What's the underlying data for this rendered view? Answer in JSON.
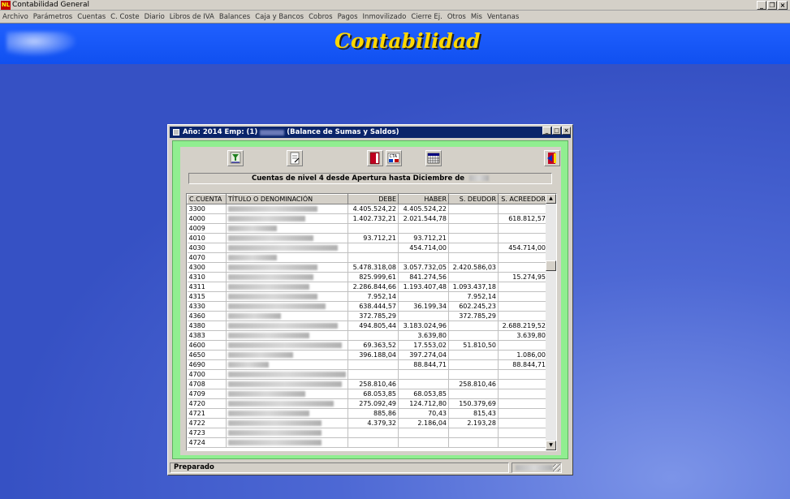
{
  "app": {
    "title": "Contabilidad General",
    "banner_title": "Contabilidad",
    "menu": [
      "Archivo",
      "Parámetros",
      "Cuentas",
      "C. Coste",
      "Diario",
      "Libros de IVA",
      "Balances",
      "Caja y Bancos",
      "Cobros",
      "Pagos",
      "Inmovilizado",
      "Cierre Ej.",
      "Otros",
      "Mis",
      "Ventanas"
    ]
  },
  "child_window": {
    "title_prefix": "Año: 2014 Emp: (1)",
    "title_suffix": "(Balance de Sumas y Saldos)",
    "header": "Cuentas de nivel 4 desde Apertura hasta Diciembre de",
    "status": "Preparado"
  },
  "toolbar_icons": [
    "filter-icon",
    "edit-document-icon",
    "exit-door-icon",
    "cta-account-icon",
    "calendar-grid-icon",
    "close-exit-icon"
  ],
  "grid": {
    "columns": [
      "C.CUENTA",
      "TÍTULO O DENOMINACIÓN",
      "DEBE",
      "HABER",
      "S. DEUDOR",
      "S. ACREEDOR"
    ],
    "rows": [
      [
        "3300",
        "",
        "4.405.524,22",
        "4.405.524,22",
        "",
        ""
      ],
      [
        "4000",
        "",
        "1.402.732,21",
        "2.021.544,78",
        "",
        "618.812,57"
      ],
      [
        "4009",
        "",
        "",
        "",
        "",
        ""
      ],
      [
        "4010",
        "",
        "93.712,21",
        "93.712,21",
        "",
        ""
      ],
      [
        "4030",
        "",
        "",
        "454.714,00",
        "",
        "454.714,00"
      ],
      [
        "4070",
        "",
        "",
        "",
        "",
        ""
      ],
      [
        "4300",
        "",
        "5.478.318,08",
        "3.057.732,05",
        "2.420.586,03",
        ""
      ],
      [
        "4310",
        "",
        "825.999,61",
        "841.274,56",
        "",
        "15.274,95"
      ],
      [
        "4311",
        "",
        "2.286.844,66",
        "1.193.407,48",
        "1.093.437,18",
        ""
      ],
      [
        "4315",
        "",
        "7.952,14",
        "",
        "7.952,14",
        ""
      ],
      [
        "4330",
        "",
        "638.444,57",
        "36.199,34",
        "602.245,23",
        ""
      ],
      [
        "4360",
        "",
        "372.785,29",
        "",
        "372.785,29",
        ""
      ],
      [
        "4380",
        "",
        "494.805,44",
        "3.183.024,96",
        "",
        "2.688.219,52"
      ],
      [
        "4383",
        "",
        "",
        "3.639,80",
        "",
        "3.639,80"
      ],
      [
        "4600",
        "",
        "69.363,52",
        "17.553,02",
        "51.810,50",
        ""
      ],
      [
        "4650",
        "",
        "396.188,04",
        "397.274,04",
        "",
        "1.086,00"
      ],
      [
        "4690",
        "",
        "",
        "88.844,71",
        "",
        "88.844,71"
      ],
      [
        "4700",
        "",
        "",
        "",
        "",
        ""
      ],
      [
        "4708",
        "",
        "258.810,46",
        "",
        "258.810,46",
        ""
      ],
      [
        "4709",
        "",
        "68.053,85",
        "68.053,85",
        "",
        ""
      ],
      [
        "4720",
        "",
        "275.092,49",
        "124.712,80",
        "150.379,69",
        ""
      ],
      [
        "4721",
        "",
        "885,86",
        "70,43",
        "815,43",
        ""
      ],
      [
        "4722",
        "",
        "4.379,32",
        "2.186,04",
        "2.193,28",
        ""
      ],
      [
        "4723",
        "",
        "",
        "",
        "",
        ""
      ],
      [
        "4724",
        "",
        "",
        "",
        "",
        ""
      ]
    ]
  }
}
